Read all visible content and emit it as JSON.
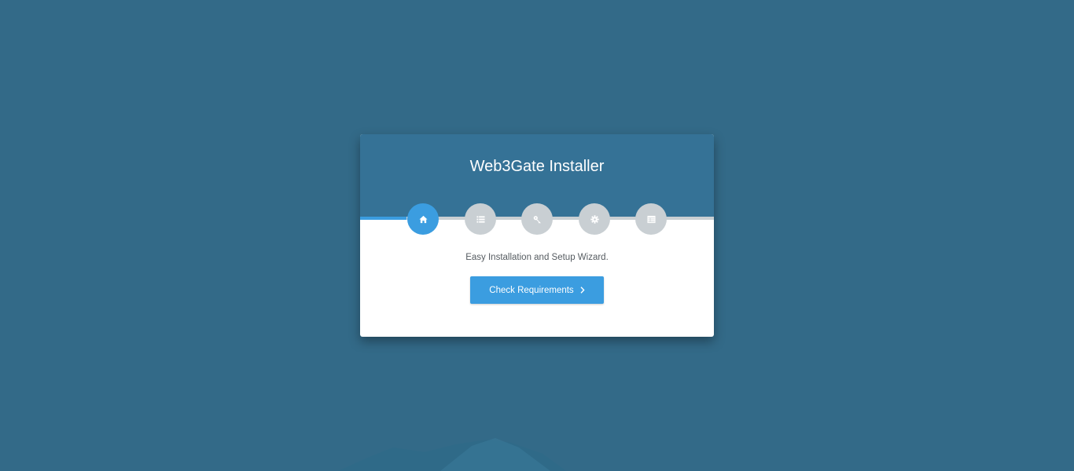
{
  "installer": {
    "title": "Web3Gate Installer",
    "tagline": "Easy Installation and Setup Wizard.",
    "primary_button_label": "Check Requirements",
    "primary_button_icon": "chevron-right-icon",
    "steps": [
      {
        "icon": "home-icon",
        "active": true
      },
      {
        "icon": "list-icon",
        "active": false
      },
      {
        "icon": "key-icon",
        "active": false
      },
      {
        "icon": "gear-icon",
        "active": false
      },
      {
        "icon": "server-icon",
        "active": false
      }
    ],
    "progress_fraction": 0.13
  },
  "colors": {
    "page_background": "#336a88",
    "header_background": "#357296",
    "accent": "#3b9de0",
    "inactive_step": "#c9cfd3",
    "text_muted": "#555b60"
  }
}
